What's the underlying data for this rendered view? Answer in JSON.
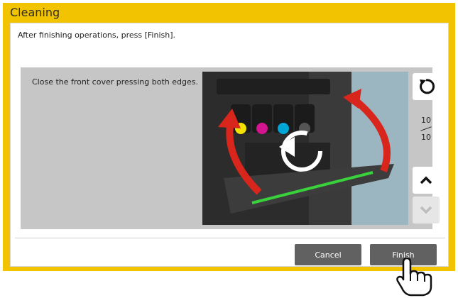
{
  "header": {
    "title": "Cleaning"
  },
  "main": {
    "instruction": "After finishing operations, press [Finish].",
    "step_text": "Close the front cover pressing both edges.",
    "pager": {
      "current": "10",
      "total": "10"
    },
    "illustration": {
      "description": "printer-front-cover-close-illustration"
    }
  },
  "footer": {
    "cancel_label": "Cancel",
    "finish_label": "Finish"
  },
  "colors": {
    "frame": "#f2c300",
    "button": "#616161",
    "content_bg": "#c6c6c6",
    "arrow_red": "#d9261c",
    "highlight_green": "#39d23c",
    "toner_yellow": "#f3e200",
    "toner_magenta": "#d4158f",
    "toner_cyan": "#00a7d6",
    "toner_black": "#222222"
  },
  "icons": {
    "restart": "restart-icon",
    "up": "chevron-up-icon",
    "down": "chevron-down-icon",
    "cursor": "hand-pointer-icon"
  }
}
